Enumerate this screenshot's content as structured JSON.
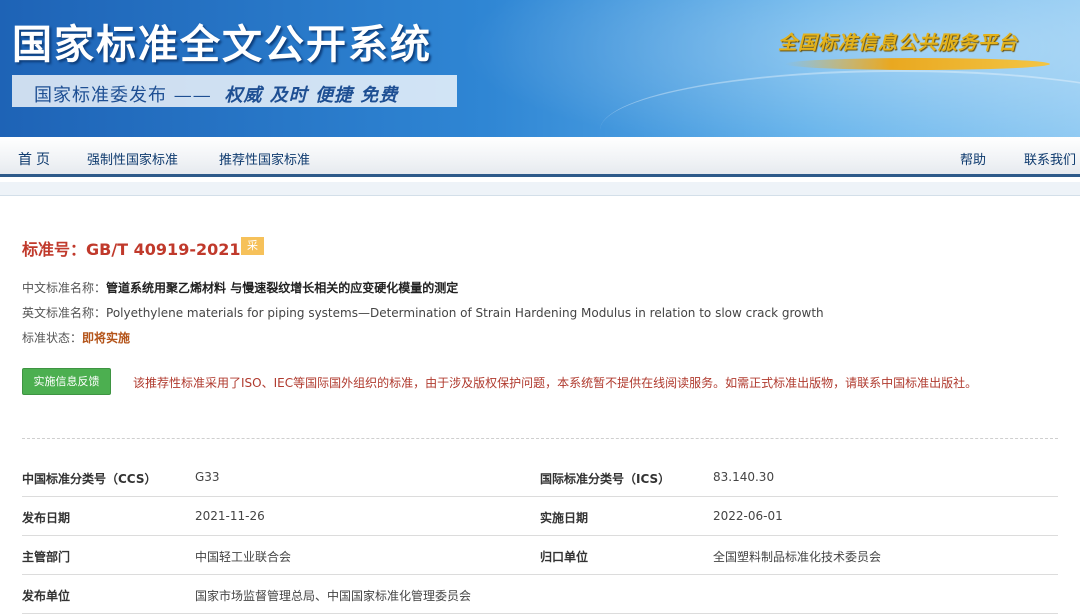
{
  "header": {
    "site_title": "国家标准全文公开系统",
    "publisher": "国家标准委发布",
    "dash": "——",
    "slogan": "权威 及时 便捷 免费",
    "platform": "全国标准信息公共服务平台"
  },
  "nav": {
    "home": "首页",
    "mandatory": "强制性国家标准",
    "recommended": "推荐性国家标准",
    "help": "帮助",
    "contact": "联系我们"
  },
  "standard": {
    "number": "标准号：GB/T 40919-2021",
    "badge": "采",
    "cn_name_label": "中文标准名称：",
    "cn_name": "管道系统用聚乙烯材料 与慢速裂纹增长相关的应变硬化模量的测定",
    "en_name_label": "英文标准名称：",
    "en_name": "Polyethylene materials for piping systems—Determination of Strain Hardening Modulus in relation to slow crack growth",
    "status_label": "标准状态：",
    "status": "即将实施"
  },
  "feedback_button": "实施信息反馈",
  "notice": "该推荐性标准采用了ISO、IEC等国际国外组织的标准，由于涉及版权保护问题，本系统暂不提供在线阅读服务。如需正式标准出版物，请联系中国标准出版社。",
  "info": {
    "ccs_label": "中国标准分类号（CCS）",
    "ccs": "G33",
    "ics_label": "国际标准分类号（ICS）",
    "ics": "83.140.30",
    "publish_date_label": "发布日期",
    "publish_date": "2021-11-26",
    "impl_date_label": "实施日期",
    "impl_date": "2022-06-01",
    "dept_label": "主管部门",
    "dept": "中国轻工业联合会",
    "tc_label": "归口单位",
    "tc": "全国塑料制品标准化技术委员会",
    "issuer_label": "发布单位",
    "issuer": "国家市场监督管理总局、中国国家标准化管理委员会"
  },
  "colors": {
    "banner_blue": "#1e63b6",
    "nav_border": "#2d5a8a",
    "standard_red": "#c0392b",
    "badge_orange": "#f6c15a",
    "button_green": "#4caf50",
    "status_orange": "#b4541a"
  }
}
